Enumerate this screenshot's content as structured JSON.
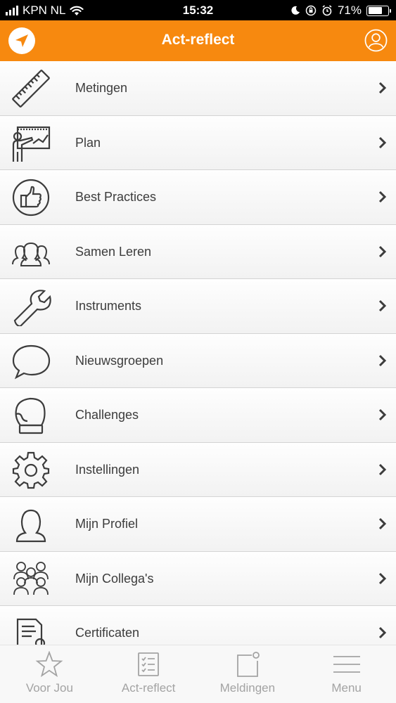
{
  "status_bar": {
    "carrier": "KPN NL",
    "time": "15:32",
    "battery": "71%",
    "battery_level": 0.71
  },
  "header": {
    "title": "Act-reflect",
    "brand_color": "#f7890f",
    "left_icon": "compass-logo-icon",
    "right_icon": "profile-icon"
  },
  "menu": {
    "items": [
      {
        "label": "Metingen",
        "icon": "ruler-icon"
      },
      {
        "label": "Plan",
        "icon": "presentation-board-icon"
      },
      {
        "label": "Best Practices",
        "icon": "thumbs-up-icon"
      },
      {
        "label": "Samen Leren",
        "icon": "group-icon"
      },
      {
        "label": "Instruments",
        "icon": "wrench-icon"
      },
      {
        "label": "Nieuwsgroepen",
        "icon": "speech-bubble-icon"
      },
      {
        "label": "Challenges",
        "icon": "boxing-glove-icon"
      },
      {
        "label": "Instellingen",
        "icon": "gear-icon"
      },
      {
        "label": "Mijn Profiel",
        "icon": "person-icon"
      },
      {
        "label": "Mijn Collega's",
        "icon": "colleagues-icon"
      },
      {
        "label": "Certificaten",
        "icon": "certificate-icon"
      }
    ]
  },
  "tabbar": {
    "tabs": [
      {
        "label": "Voor Jou",
        "icon": "star-icon"
      },
      {
        "label": "Act-reflect",
        "icon": "checklist-icon"
      },
      {
        "label": "Meldingen",
        "icon": "notification-icon"
      },
      {
        "label": "Menu",
        "icon": "hamburger-menu-icon"
      }
    ]
  }
}
